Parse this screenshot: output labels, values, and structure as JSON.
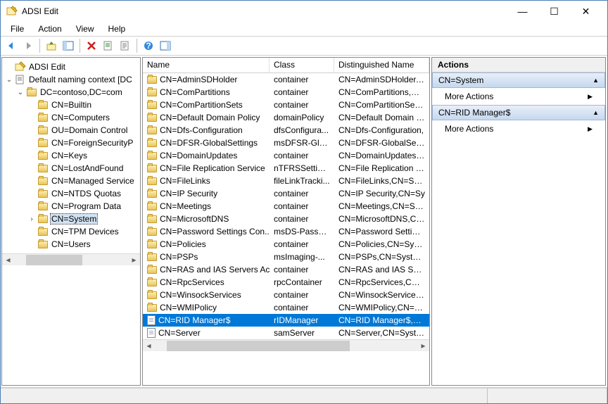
{
  "window": {
    "title": "ADSI Edit"
  },
  "menu": {
    "file": "File",
    "action": "Action",
    "view": "View",
    "help": "Help"
  },
  "tree": {
    "root": "ADSI Edit",
    "context": "Default naming context [DC",
    "dc": "DC=contoso,DC=com",
    "nodes": [
      "CN=Builtin",
      "CN=Computers",
      "OU=Domain Control",
      "CN=ForeignSecurityP",
      "CN=Keys",
      "CN=LostAndFound",
      "CN=Managed Service",
      "CN=NTDS Quotas",
      "CN=Program Data",
      "CN=System",
      "CN=TPM Devices",
      "CN=Users"
    ],
    "selected": "CN=System"
  },
  "list": {
    "headers": {
      "name": "Name",
      "class": "Class",
      "dn": "Distinguished Name"
    },
    "rows": [
      {
        "name": "CN=AdminSDHolder",
        "class": "container",
        "dn": "CN=AdminSDHolder,CN",
        "icon": "folder"
      },
      {
        "name": "CN=ComPartitions",
        "class": "container",
        "dn": "CN=ComPartitions,CN=",
        "icon": "folder"
      },
      {
        "name": "CN=ComPartitionSets",
        "class": "container",
        "dn": "CN=ComPartitionSets,C",
        "icon": "folder"
      },
      {
        "name": "CN=Default Domain Policy",
        "class": "domainPolicy",
        "dn": "CN=Default Domain Po",
        "icon": "folder"
      },
      {
        "name": "CN=Dfs-Configuration",
        "class": "dfsConfigura...",
        "dn": "CN=Dfs-Configuration,",
        "icon": "folder"
      },
      {
        "name": "CN=DFSR-GlobalSettings",
        "class": "msDFSR-Glo...",
        "dn": "CN=DFSR-GlobalSetting",
        "icon": "folder"
      },
      {
        "name": "CN=DomainUpdates",
        "class": "container",
        "dn": "CN=DomainUpdates,CN",
        "icon": "folder"
      },
      {
        "name": "CN=File Replication Service",
        "class": "nTFRSSettings",
        "dn": "CN=File Replication Ser",
        "icon": "folder"
      },
      {
        "name": "CN=FileLinks",
        "class": "fileLinkTracki...",
        "dn": "CN=FileLinks,CN=Syste",
        "icon": "folder"
      },
      {
        "name": "CN=IP Security",
        "class": "container",
        "dn": "CN=IP Security,CN=Sy",
        "icon": "folder"
      },
      {
        "name": "CN=Meetings",
        "class": "container",
        "dn": "CN=Meetings,CN=Syste",
        "icon": "folder"
      },
      {
        "name": "CN=MicrosoftDNS",
        "class": "container",
        "dn": "CN=MicrosoftDNS,CN=",
        "icon": "folder"
      },
      {
        "name": "CN=Password Settings Con...",
        "class": "msDS-Passw...",
        "dn": "CN=Password Settings C",
        "icon": "folder"
      },
      {
        "name": "CN=Policies",
        "class": "container",
        "dn": "CN=Policies,CN=System",
        "icon": "folder"
      },
      {
        "name": "CN=PSPs",
        "class": "msImaging-...",
        "dn": "CN=PSPs,CN=System,D",
        "icon": "folder"
      },
      {
        "name": "CN=RAS and IAS Servers Ac...",
        "class": "container",
        "dn": "CN=RAS and IAS Servers",
        "icon": "folder"
      },
      {
        "name": "CN=RpcServices",
        "class": "rpcContainer",
        "dn": "CN=RpcServices,CN=Sy",
        "icon": "folder"
      },
      {
        "name": "CN=WinsockServices",
        "class": "container",
        "dn": "CN=WinsockServices,CN",
        "icon": "folder"
      },
      {
        "name": "CN=WMIPolicy",
        "class": "container",
        "dn": "CN=WMIPolicy,CN=Sys",
        "icon": "folder"
      },
      {
        "name": "CN=RID Manager$",
        "class": "rIDManager",
        "dn": "CN=RID Manager$,CN=",
        "icon": "doc",
        "selected": true
      },
      {
        "name": "CN=Server",
        "class": "samServer",
        "dn": "CN=Server,CN=System,",
        "icon": "doc"
      }
    ]
  },
  "actions": {
    "title": "Actions",
    "section1": "CN=System",
    "more1": "More Actions",
    "section2": "CN=RID Manager$",
    "more2": "More Actions"
  }
}
